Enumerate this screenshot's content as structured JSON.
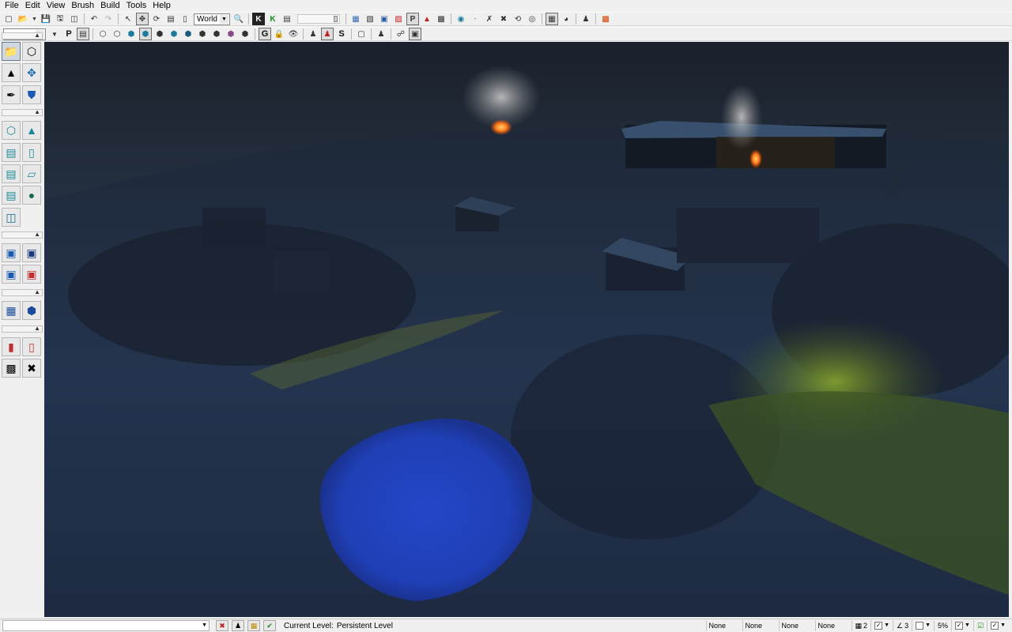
{
  "menu": [
    "File",
    "Edit",
    "View",
    "Brush",
    "Build",
    "Tools",
    "Help"
  ],
  "toolbar1": {
    "coord_system": "World"
  },
  "toolbar2": {
    "letters": {
      "p1": "P",
      "g": "G",
      "s": "S"
    }
  },
  "viewport": {
    "colors": {
      "sky": "#1a212c",
      "ground": "#263248",
      "grass": "#6f8a2a",
      "fire": "#ff7a1a",
      "smoke": "#c9c9c9",
      "blob": "#1f3fbf"
    }
  },
  "statusbar": {
    "current_level_label": "Current Level:",
    "current_level_value": "Persistent Level",
    "fields": [
      "None",
      "None",
      "None",
      "None"
    ],
    "grid_value": "2",
    "angle_value": "3",
    "zoom_value": "5%"
  }
}
